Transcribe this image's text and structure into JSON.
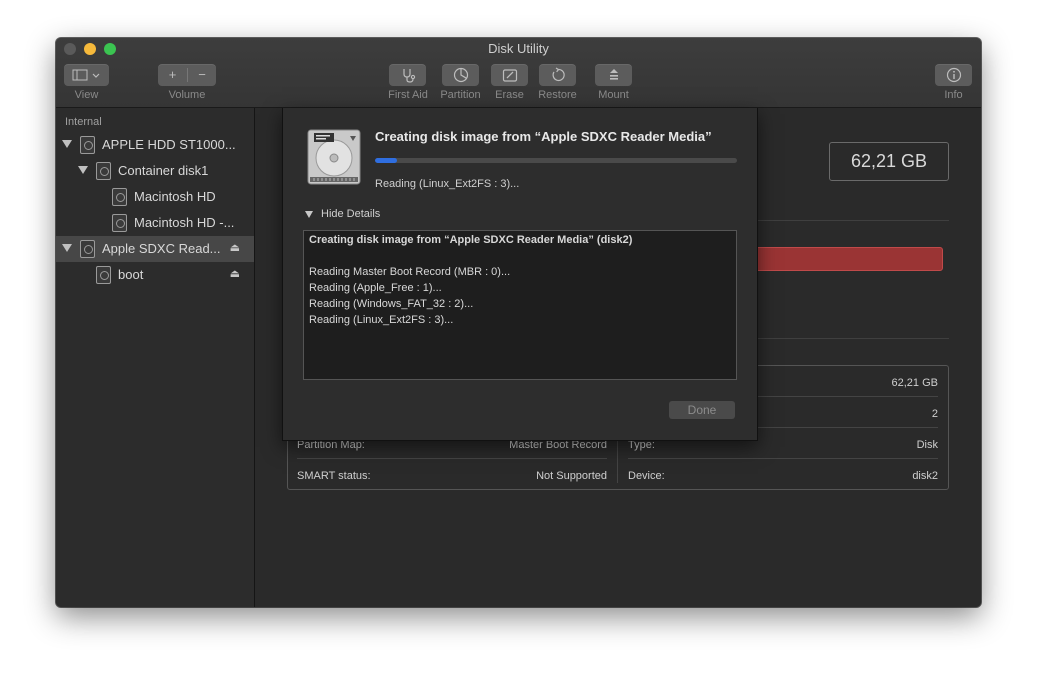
{
  "window": {
    "title": "Disk Utility"
  },
  "toolbar": {
    "view_label": "View",
    "volume_label": "Volume",
    "volume_add": "+",
    "volume_remove": "−",
    "first_aid_label": "First Aid",
    "partition_label": "Partition",
    "erase_label": "Erase",
    "restore_label": "Restore",
    "mount_label": "Mount",
    "info_label": "Info"
  },
  "sidebar": {
    "header": "Internal",
    "items": [
      {
        "label": "APPLE HDD ST1000..."
      },
      {
        "label": "Container disk1"
      },
      {
        "label": "Macintosh HD"
      },
      {
        "label": "Macintosh HD -..."
      },
      {
        "label": "Apple SDXC Read..."
      },
      {
        "label": "boot"
      }
    ]
  },
  "main": {
    "capacity": "62,21 GB",
    "usage_fraction": 1.0,
    "info_table": {
      "partition_map_label": "Partition Map:",
      "partition_map_value": "Master Boot Record",
      "smart_label": "SMART status:",
      "smart_value": "Not Supported",
      "right_capacity_value": "62,21 GB",
      "right_child_count_value": "2",
      "type_label": "Type:",
      "type_value": "Disk",
      "device_label": "Device:",
      "device_value": "disk2"
    }
  },
  "sheet": {
    "title": "Creating disk image from “Apple SDXC Reader Media”",
    "progress_fraction": 0.06,
    "status": "Reading  (Linux_Ext2FS : 3)...",
    "details_toggle": "Hide Details",
    "log_lines": [
      "Creating disk image from “Apple SDXC Reader Media” (disk2)",
      "",
      "Reading Master Boot Record (MBR : 0)...",
      "Reading  (Apple_Free : 1)...",
      "Reading  (Windows_FAT_32 : 2)...",
      "Reading  (Linux_Ext2FS : 3)..."
    ],
    "done_label": "Done"
  },
  "colors": {
    "accent": "#2f6ee0",
    "usage": "#9a3434"
  }
}
